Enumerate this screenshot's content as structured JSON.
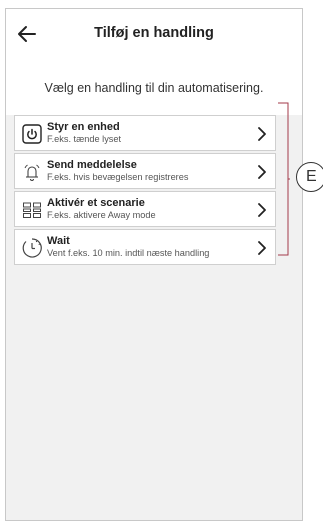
{
  "header": {
    "title": "Tilføj en handling"
  },
  "subtitle": "Vælg en handling til din automatisering.",
  "actions": [
    {
      "label": "Styr en enhed",
      "description": "F.eks. tænde lyset",
      "icon": "power-icon"
    },
    {
      "label": "Send meddelelse",
      "description": "F.eks. hvis bevægelsen registreres",
      "icon": "bell-icon"
    },
    {
      "label": "Aktivér et scenarie",
      "description": "F.eks. aktivere Away mode",
      "icon": "scene-icon"
    },
    {
      "label": "Wait",
      "description": "Vent f.eks. 10 min. indtil næste handling",
      "icon": "timer-icon"
    }
  ],
  "callout": {
    "label": "E"
  },
  "colors": {
    "background": "#f1f1f1",
    "card": "#ffffff",
    "text": "#222222"
  }
}
